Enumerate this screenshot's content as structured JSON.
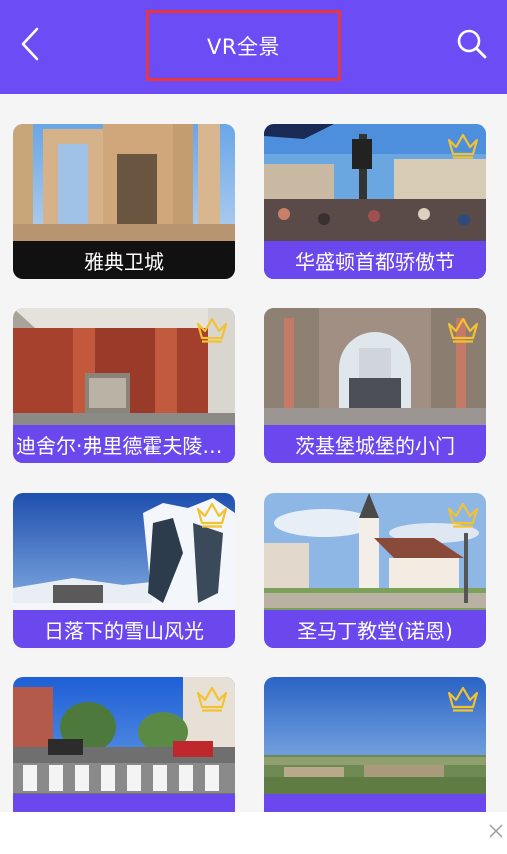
{
  "header": {
    "title": "VR全景",
    "back_icon": "chevron-left-icon",
    "search_icon": "search-icon",
    "background_color": "#6c4cf4",
    "highlight_border_color": "#e8353f"
  },
  "cards": [
    {
      "caption": "雅典卫城",
      "premium": false
    },
    {
      "caption": "华盛顿首都骄傲节",
      "premium": true
    },
    {
      "caption": "迪舍尔·弗里德霍夫陵…",
      "premium": true
    },
    {
      "caption": "茨基堡城堡的小门",
      "premium": true
    },
    {
      "caption": "日落下的雪山风光",
      "premium": true
    },
    {
      "caption": "圣马丁教堂(诺恩)",
      "premium": true
    },
    {
      "caption": "",
      "premium": true
    },
    {
      "caption": "",
      "premium": true
    }
  ],
  "colors": {
    "caption_purple": "#6b48ee",
    "caption_dark": "#111111",
    "crown": "#f2c230"
  },
  "footer": {
    "close_icon": "close-icon"
  }
}
